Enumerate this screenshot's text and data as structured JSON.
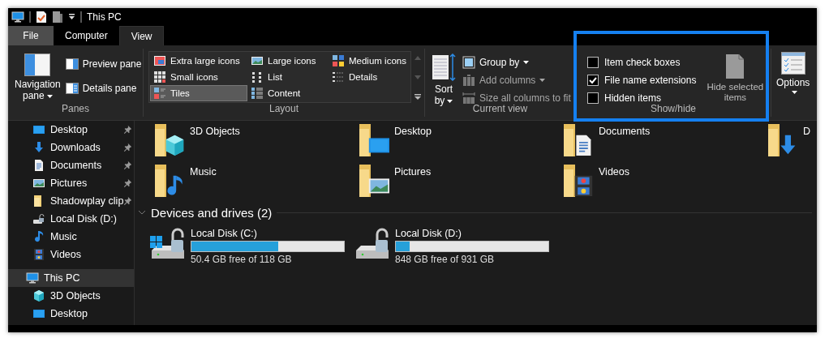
{
  "window": {
    "title": "This PC"
  },
  "tabs": [
    {
      "label": "File",
      "kind": "file",
      "selected": false
    },
    {
      "label": "Computer",
      "kind": "tab",
      "selected": false
    },
    {
      "label": "View",
      "kind": "tab",
      "selected": true
    }
  ],
  "ribbon": {
    "panes": {
      "label": "Panes",
      "navigation_pane": "Navigation pane",
      "preview_pane": "Preview pane",
      "details_pane": "Details pane"
    },
    "layout": {
      "label": "Layout",
      "options": [
        {
          "label": "Extra large icons",
          "selected": false
        },
        {
          "label": "Large icons",
          "selected": false
        },
        {
          "label": "Medium icons",
          "selected": false
        },
        {
          "label": "Small icons",
          "selected": false
        },
        {
          "label": "List",
          "selected": false
        },
        {
          "label": "Details",
          "selected": false
        },
        {
          "label": "Tiles",
          "selected": true
        },
        {
          "label": "Content",
          "selected": false
        }
      ]
    },
    "current_view": {
      "label": "Current view",
      "sort_by": "Sort by",
      "commands": [
        {
          "label": "Group by",
          "dropdown": true,
          "disabled": false
        },
        {
          "label": "Add columns",
          "dropdown": true,
          "disabled": true
        },
        {
          "label": "Size all columns to fit",
          "dropdown": false,
          "disabled": true
        }
      ]
    },
    "show_hide": {
      "label": "Show/hide",
      "checkboxes": [
        {
          "label": "Item check boxes",
          "checked": false
        },
        {
          "label": "File name extensions",
          "checked": true
        },
        {
          "label": "Hidden items",
          "checked": false
        }
      ],
      "hide_selected": {
        "label": "Hide selected items",
        "disabled": true
      }
    },
    "options": {
      "label": "Options"
    }
  },
  "sidebar": {
    "quick_access": [
      {
        "label": "Desktop",
        "kind": "desktop",
        "pinned": true,
        "selected": false
      },
      {
        "label": "Downloads",
        "kind": "download",
        "pinned": true,
        "selected": false
      },
      {
        "label": "Documents",
        "kind": "document",
        "pinned": true,
        "selected": false
      },
      {
        "label": "Pictures",
        "kind": "pictures",
        "pinned": true,
        "selected": false
      },
      {
        "label": "Shadowplay clip",
        "kind": "folder",
        "pinned": true,
        "selected": false
      },
      {
        "label": "Local Disk (D:)",
        "kind": "disk",
        "pinned": false,
        "selected": false
      },
      {
        "label": "Music",
        "kind": "music",
        "pinned": false,
        "selected": false
      },
      {
        "label": "Videos",
        "kind": "videos",
        "pinned": false,
        "selected": false
      }
    ],
    "this_pc": {
      "label": "This PC",
      "kind": "monitor",
      "selected": true,
      "children": [
        {
          "label": "3D Objects",
          "kind": "cube",
          "selected": false
        },
        {
          "label": "Desktop",
          "kind": "desktop",
          "selected": false
        }
      ]
    }
  },
  "folders": [
    {
      "label": "3D Objects",
      "kind": "cube"
    },
    {
      "label": "Desktop",
      "kind": "desktop"
    },
    {
      "label": "Documents",
      "kind": "document"
    },
    {
      "label": "D",
      "kind": "download"
    },
    {
      "label": "Music",
      "kind": "music"
    },
    {
      "label": "Pictures",
      "kind": "pictures"
    },
    {
      "label": "Videos",
      "kind": "videos"
    }
  ],
  "devices": {
    "header": "Devices and drives (2)",
    "expanded": true,
    "drives": [
      {
        "label": "Local Disk (C:)",
        "kind": "system",
        "level": 0.57,
        "free": "50.4 GB free of 118 GB"
      },
      {
        "label": "Local Disk (D:)",
        "kind": "data",
        "level": 0.09,
        "free": "848 GB free of 931 GB"
      }
    ]
  }
}
